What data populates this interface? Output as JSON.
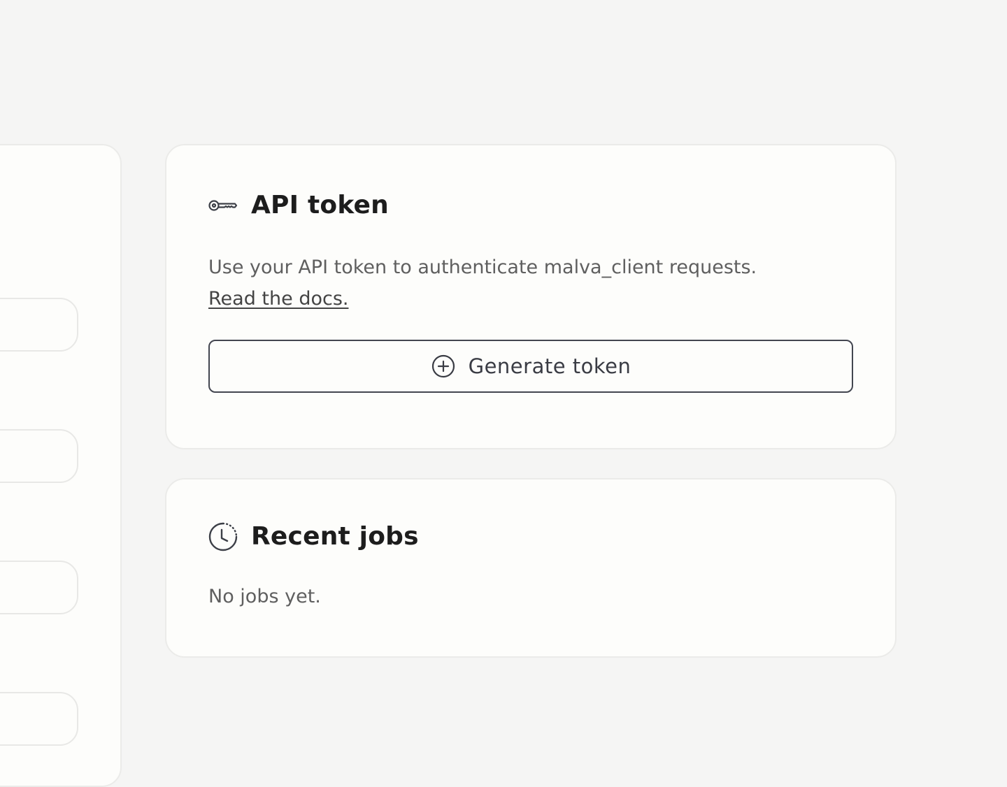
{
  "api_token_card": {
    "title": "API token",
    "icon": "key-icon",
    "description": "Use your API token to authenticate malva_client requests.",
    "docs_link": "Read the docs.",
    "generate_button": {
      "label": "Generate token",
      "icon": "plus-circle-icon"
    }
  },
  "recent_jobs_card": {
    "title": "Recent jobs",
    "icon": "history-clock-icon",
    "empty_text": "No jobs yet."
  },
  "colors": {
    "background": "#f5f5f4",
    "card": "#fdfdfb",
    "border": "#ebebe9",
    "button_border": "#434650",
    "text_muted": "#5f5f5f"
  }
}
